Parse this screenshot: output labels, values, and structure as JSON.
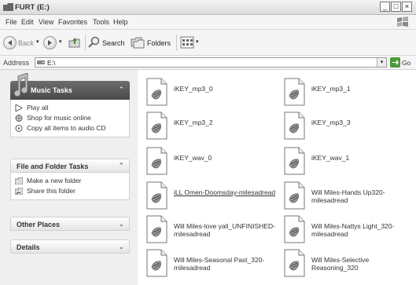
{
  "window": {
    "title": "FURT (E:)",
    "controls": {
      "minimize": "_",
      "maximize": "□",
      "close": "×"
    }
  },
  "menu": [
    "File",
    "Edit",
    "View",
    "Favorites",
    "Tools",
    "Help"
  ],
  "toolbar": {
    "back_label": "Back",
    "search_label": "Search",
    "folders_label": "Folders"
  },
  "address": {
    "label": "Address",
    "value": "E:\\",
    "go_label": "Go"
  },
  "sidebar": {
    "music_tasks": {
      "title": "Music Tasks",
      "items": [
        "Play all",
        "Shop for music online",
        "Copy all items to audio CD"
      ]
    },
    "file_folder_tasks": {
      "title": "File and Folder Tasks",
      "items": [
        "Make a new folder",
        "Share this folder"
      ]
    },
    "other_places": {
      "title": "Other Places"
    },
    "details": {
      "title": "Details"
    }
  },
  "files": [
    {
      "name": "iKEY_mp3_0"
    },
    {
      "name": "iKEY_mp3_1"
    },
    {
      "name": "iKEY_mp3_2"
    },
    {
      "name": "iKEY_mp3_3"
    },
    {
      "name": "iKEY_wav_0"
    },
    {
      "name": "iKEY_wav_1"
    },
    {
      "name": "iLL Omen-Doomsday-milesadread",
      "selected": true
    },
    {
      "name": "Will Miles-Hands Up320-milesadread"
    },
    {
      "name": "Will Miles-love yall_UNFINISHED-milesadread"
    },
    {
      "name": "Will Miles-Nattys Light_320-milesadread"
    },
    {
      "name": "Will Miles-Seasonal Past_320-milesadread"
    },
    {
      "name": "Will Miles-Selective Reasoning_320"
    }
  ]
}
